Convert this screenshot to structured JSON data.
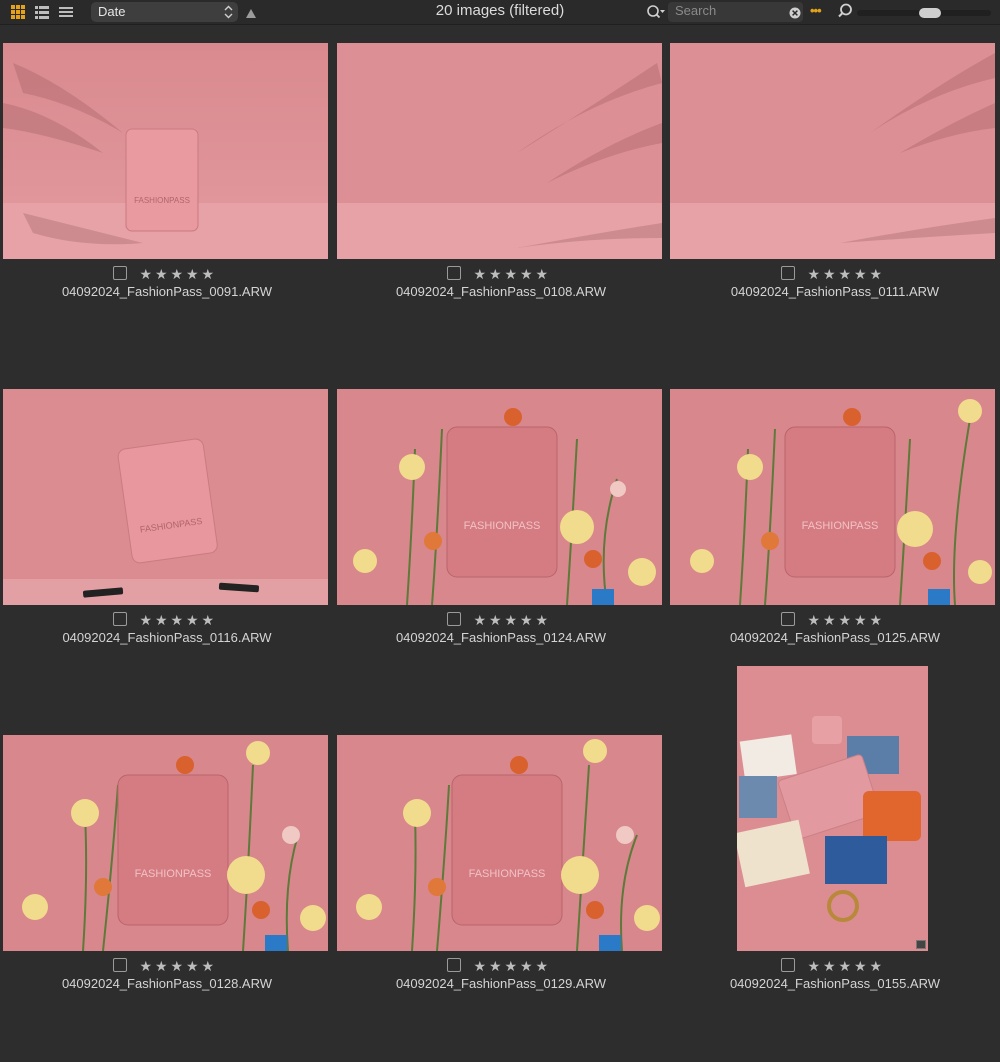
{
  "toolbar": {
    "views": [
      {
        "icon": "grid-view-icon",
        "active": true
      },
      {
        "icon": "list-view-icon",
        "active": false
      },
      {
        "icon": "filmstrip-view-icon",
        "active": false
      }
    ],
    "sort_label": "Date",
    "sort_direction": "ascending",
    "title": "20 images (filtered)",
    "search_placeholder": "Search",
    "zoom_level": 0.55,
    "accent_color": "#e3a21a"
  },
  "images": [
    {
      "filename": "04092024_FashionPass_0091.ARW",
      "rating": 5,
      "checked": false
    },
    {
      "filename": "04092024_FashionPass_0108.ARW",
      "rating": 5,
      "checked": false
    },
    {
      "filename": "04092024_FashionPass_0111.ARW",
      "rating": 5,
      "checked": false
    },
    {
      "filename": "04092024_FashionPass_0116.ARW",
      "rating": 5,
      "checked": false
    },
    {
      "filename": "04092024_FashionPass_0124.ARW",
      "rating": 5,
      "checked": false
    },
    {
      "filename": "04092024_FashionPass_0125.ARW",
      "rating": 5,
      "checked": false
    },
    {
      "filename": "04092024_FashionPass_0128.ARW",
      "rating": 5,
      "checked": false
    },
    {
      "filename": "04092024_FashionPass_0129.ARW",
      "rating": 5,
      "checked": false
    },
    {
      "filename": "04092024_FashionPass_0155.ARW",
      "rating": 5,
      "checked": false
    }
  ],
  "bag_text": "FASHIONPASS"
}
